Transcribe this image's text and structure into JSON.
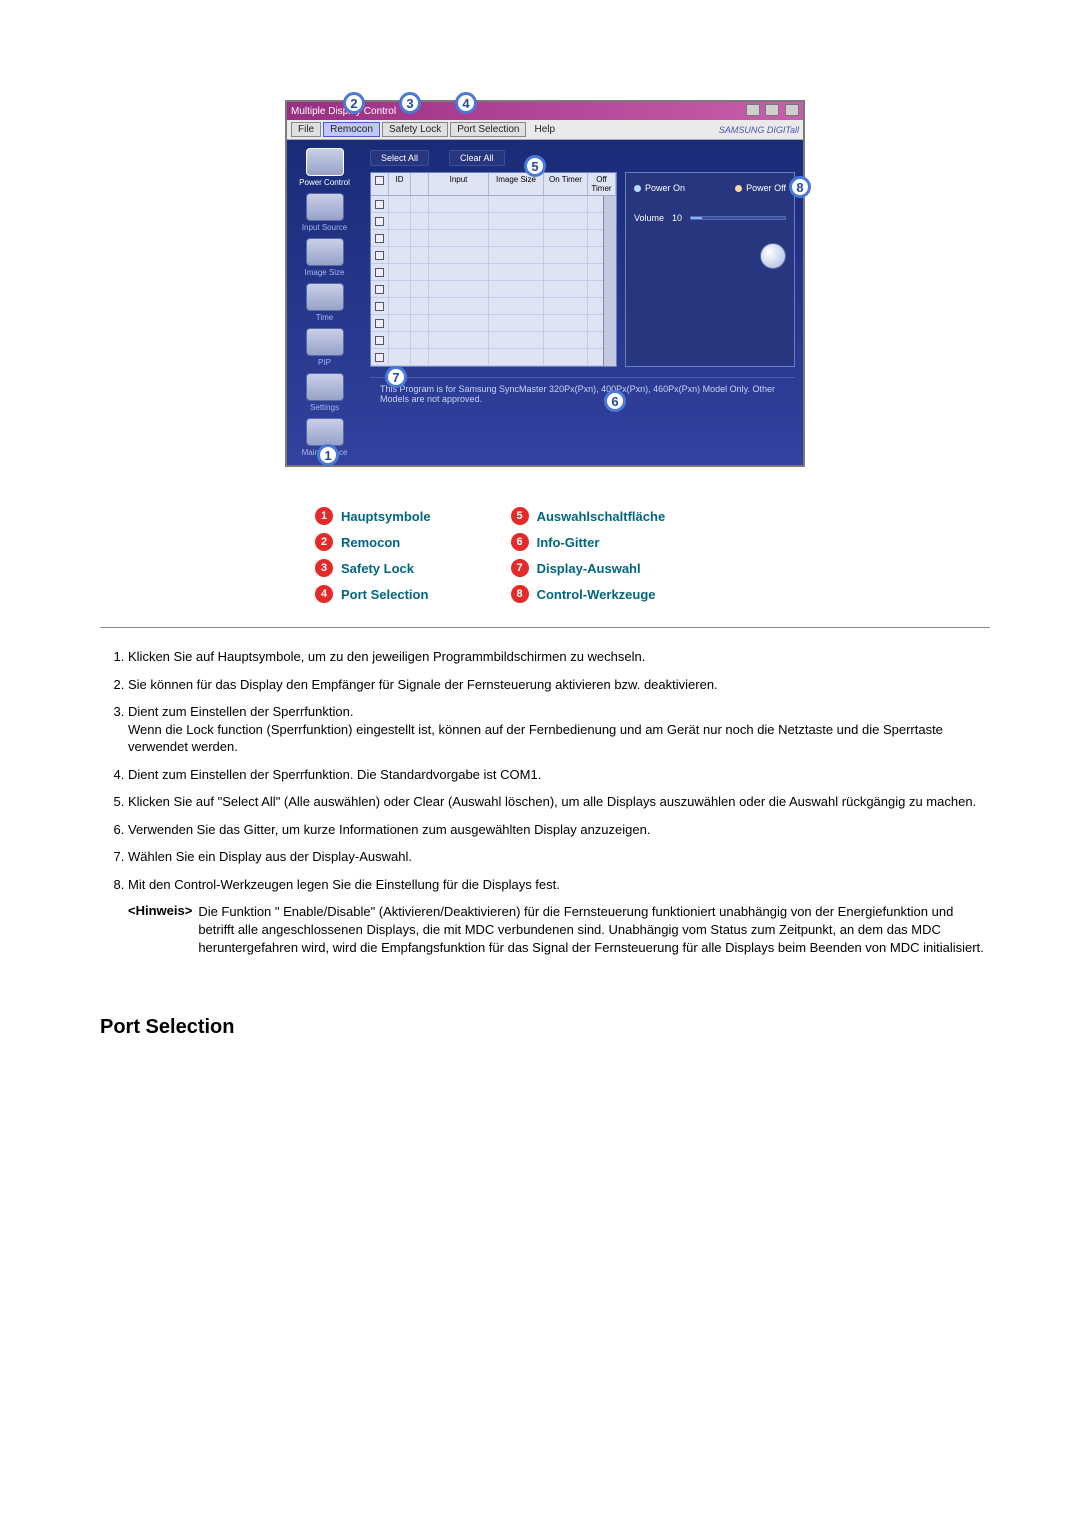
{
  "app": {
    "title": "Multiple Display Control",
    "brand": "SAMSUNG DIGITall",
    "menu": {
      "file": "File",
      "remocon": "Remocon",
      "safety": "Safety Lock",
      "port": "Port Selection",
      "help": "Help"
    },
    "sidebar": [
      {
        "label": "Power Control"
      },
      {
        "label": "Input Source"
      },
      {
        "label": "Image Size"
      },
      {
        "label": "Time"
      },
      {
        "label": "PIP"
      },
      {
        "label": "Settings"
      },
      {
        "label": "Maintenance"
      }
    ],
    "toolbar": {
      "select_all": "Select All",
      "clear_all": "Clear All"
    },
    "grid_headers": {
      "chk": "",
      "id": "ID",
      "star": "",
      "input": "Input",
      "imgsize": "Image Size",
      "ontimer": "On Timer",
      "offtimer": "Off Timer"
    },
    "control": {
      "power_on": "Power On",
      "power_off": "Power Off",
      "volume_label": "Volume",
      "volume_value": "10"
    },
    "footer": "This Program is for Samsung SyncMaster 320Px(Pxn), 400Px(Pxn), 460Px(Pxn)  Model Only. Other Models are not approved."
  },
  "legend": {
    "left": [
      {
        "n": "1",
        "label": "Hauptsymbole"
      },
      {
        "n": "2",
        "label": "Remocon"
      },
      {
        "n": "3",
        "label": "Safety Lock"
      },
      {
        "n": "4",
        "label": "Port Selection"
      }
    ],
    "right": [
      {
        "n": "5",
        "label": "Auswahlschaltfläche"
      },
      {
        "n": "6",
        "label": "Info-Gitter"
      },
      {
        "n": "7",
        "label": "Display-Auswahl"
      },
      {
        "n": "8",
        "label": "Control-Werkzeuge"
      }
    ]
  },
  "descriptions": [
    "Klicken Sie auf Hauptsymbole, um zu den jeweiligen Programmbildschirmen zu wechseln.",
    "Sie können für das Display den Empfänger für Signale der Fernsteuerung aktivieren bzw. deaktivieren.",
    "Dient zum Einstellen der Sperrfunktion.\nWenn die Lock function (Sperrfunktion) eingestellt ist, können auf der Fernbedienung und am Gerät nur noch die Netztaste und die Sperrtaste verwendet werden.",
    "Dient zum Einstellen der Sperrfunktion. Die Standardvorgabe ist COM1.",
    "Klicken Sie auf \"Select All\" (Alle auswählen) oder Clear (Auswahl löschen), um alle Displays auszuwählen oder die Auswahl rückgängig zu machen.",
    "Verwenden Sie das Gitter, um kurze Informationen zum ausgewählten Display anzuzeigen.",
    "Wählen Sie ein Display aus der Display-Auswahl.",
    "Mit den Control-Werkzeugen legen Sie die Einstellung für die Displays fest."
  ],
  "note": {
    "tag": "<Hinweis>",
    "body": "Die Funktion \" Enable/Disable\" (Aktivieren/Deaktivieren) für die Fernsteuerung funktioniert unabhängig von der Energiefunktion und betrifft alle angeschlossenen Displays, die mit MDC verbundenen sind. Unabhängig vom Status zum Zeitpunkt, an dem das MDC heruntergefahren wird, wird die Empfangsfunktion für das Signal der Fernsteuerung für alle Displays beim Beenden von MDC initialisiert."
  },
  "section_heading": "Port Selection"
}
